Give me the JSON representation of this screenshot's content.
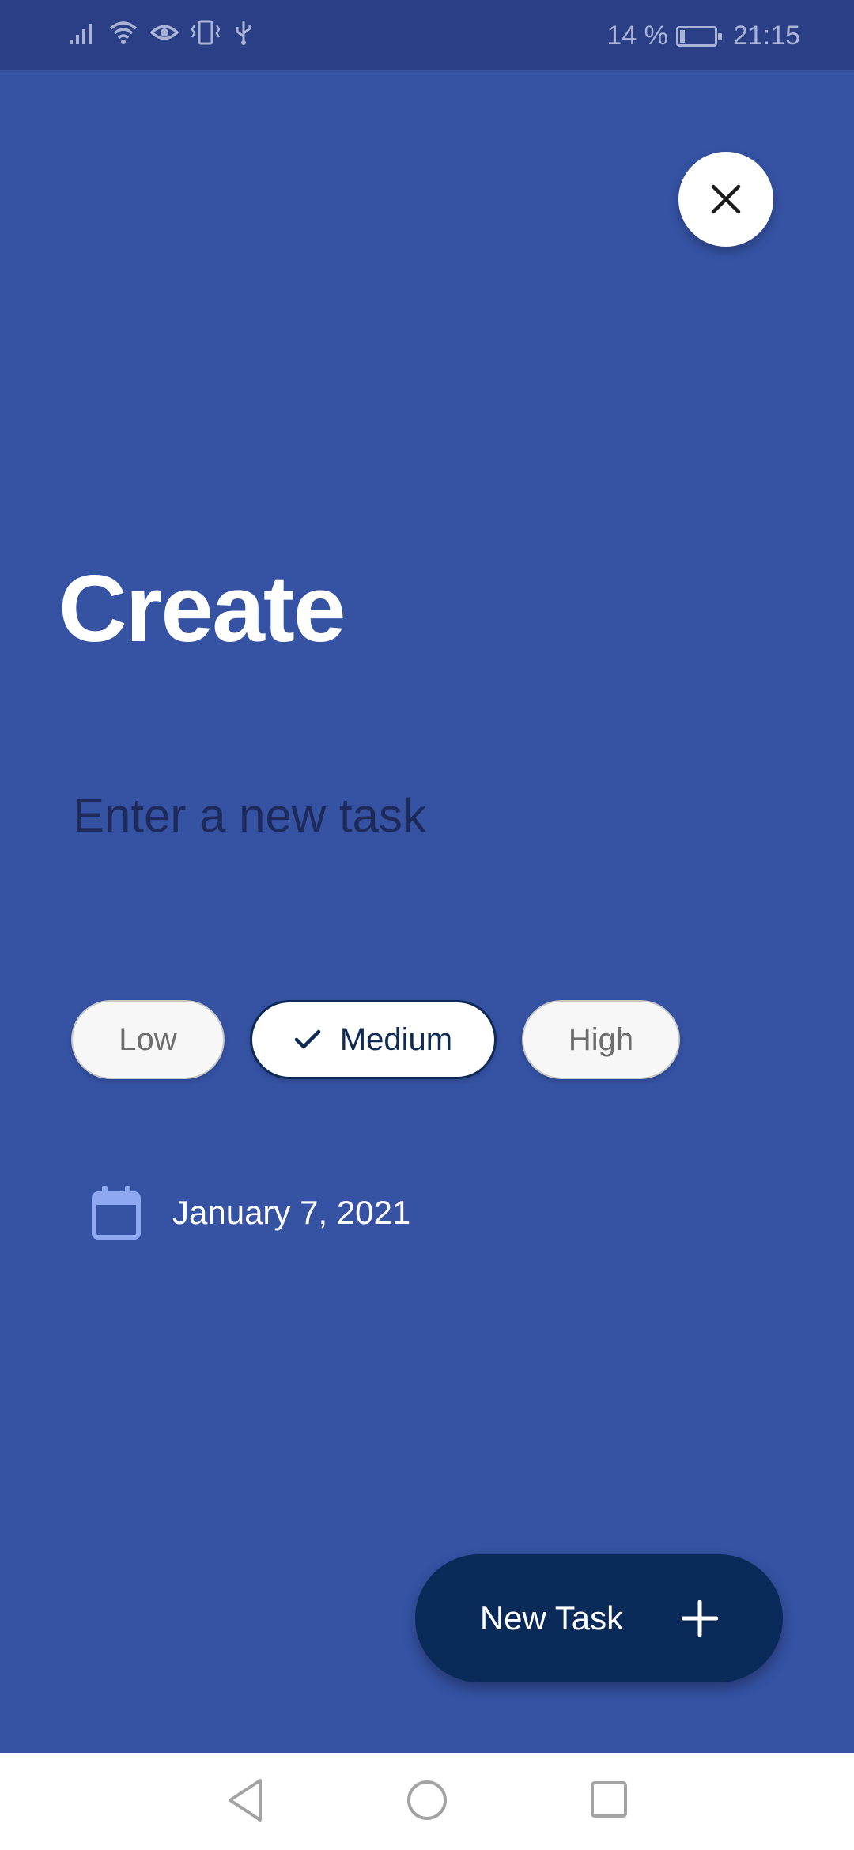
{
  "status_bar": {
    "battery_percent": "14 %",
    "time": "21:15",
    "icons": [
      "signal-icon",
      "wifi-icon",
      "eye-icon",
      "vibrate-icon",
      "usb-icon",
      "battery-icon"
    ]
  },
  "header": {
    "close_icon": "close-icon"
  },
  "title": "Create",
  "task_input": {
    "placeholder": "Enter a new task",
    "value": ""
  },
  "priority": {
    "options": [
      {
        "label": "Low",
        "selected": false
      },
      {
        "label": "Medium",
        "selected": true
      },
      {
        "label": "High",
        "selected": false
      }
    ]
  },
  "date": {
    "label": "January 7, 2021",
    "icon": "calendar-icon"
  },
  "fab": {
    "label": "New Task",
    "icon": "plus-icon"
  },
  "nav": {
    "buttons": [
      "back-icon",
      "home-icon",
      "recents-icon"
    ]
  },
  "colors": {
    "background": "#3552a3",
    "status_bar": "#2a3f85",
    "fab": "#0a2a5a",
    "calendar_icon": "#8ea8f2"
  }
}
